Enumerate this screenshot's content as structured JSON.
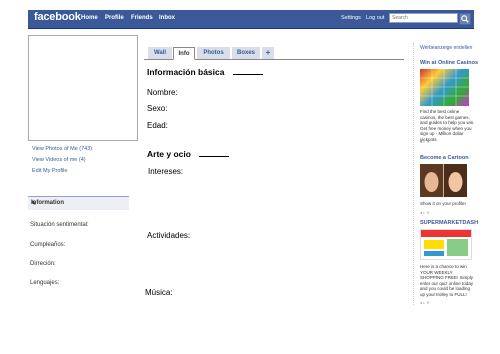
{
  "brand": {
    "logo": "facebook",
    "color": "#3b5998"
  },
  "topnav": {
    "items": [
      "Home",
      "Profile",
      "Friends",
      "Inbox"
    ],
    "settings": "Settings",
    "logout": "Log out",
    "search_placeholder": "Search"
  },
  "left": {
    "links": [
      "View Photos of Me (743)",
      "View Videos of me (4)",
      "Edit My Profile"
    ],
    "info_title": "Information",
    "fields": [
      "Situación sentimental:",
      "Cumpleaños:",
      "Dirreción:",
      "Lenguajes:"
    ]
  },
  "tabs": [
    "Wall",
    "Info",
    "Photos",
    "Boxes",
    "+"
  ],
  "main": {
    "basic_title": "Información básica",
    "basic_fields": [
      "Nombre:",
      "Sexo:",
      "Edad:"
    ],
    "arts_title": "Arte y ocio",
    "intereses": "Intereses:",
    "actividades": "Actividades:",
    "musica": "Música:"
  },
  "ads": {
    "create": "Werbeanzeige erstellen",
    "items": [
      {
        "title": "Win at Online Casinos",
        "text": "Find the best online casinos, the best games, and guides to help you win. Get free money when you sign up - Million dollar jackpots.",
        "icon": "casino-image"
      },
      {
        "title": "Become a Cartoon",
        "text": "Show it on your profile!",
        "icon": "cartoon-faces-image"
      },
      {
        "title": "SUPERMARKETDASH",
        "text": "Here is a chance to win YOUR WEEKLY SHOPPING FREE! Simply enter our quiz online today and you could be loading up your trolley to FULL!",
        "icon": "supermarket-banner-image"
      }
    ]
  }
}
